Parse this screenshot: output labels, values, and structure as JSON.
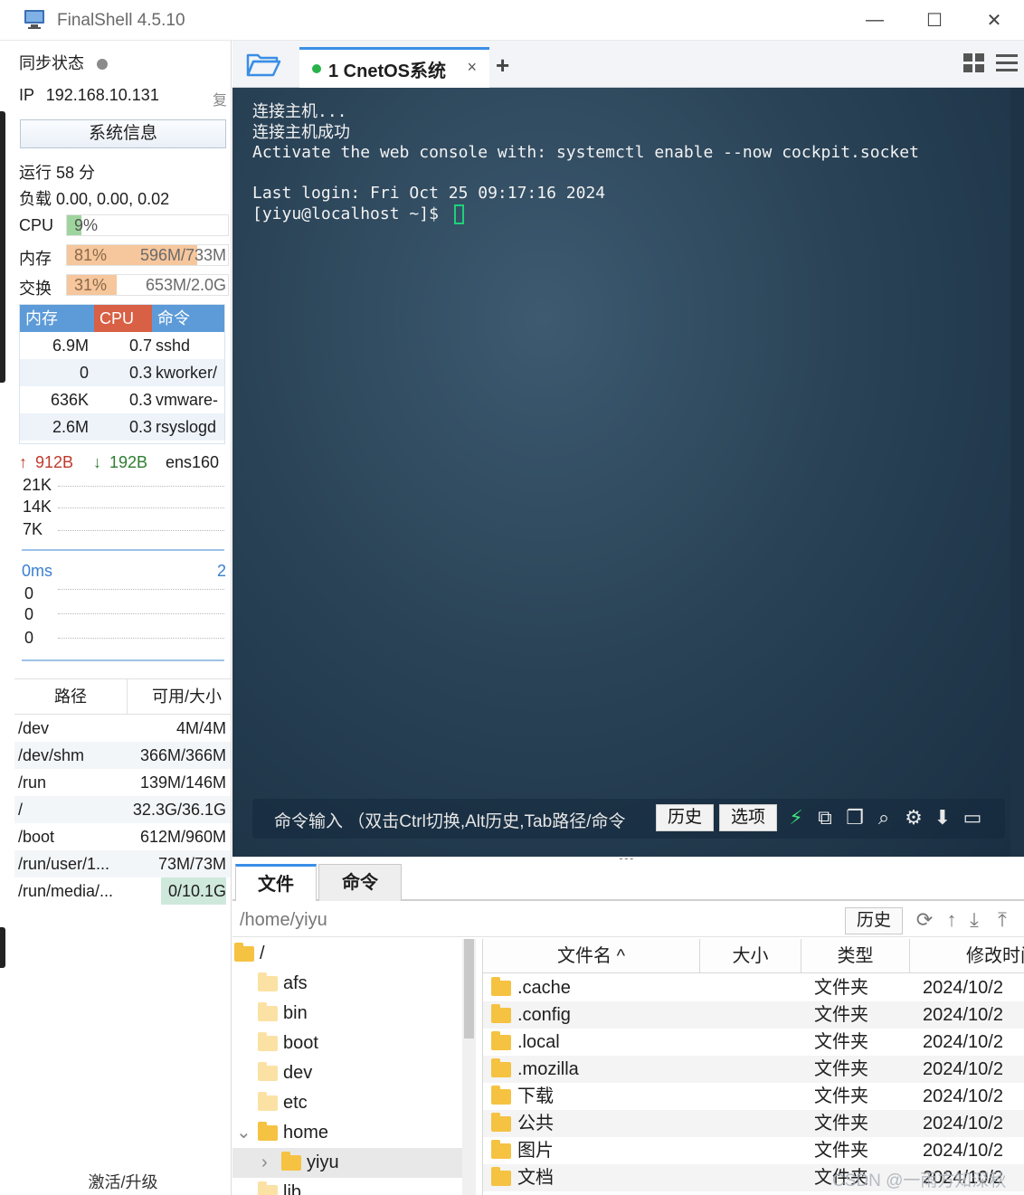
{
  "window": {
    "title": "FinalShell 4.5.10",
    "minimize": "—",
    "maximize": "☐",
    "close": "✕"
  },
  "sidebar": {
    "sync_label": "同步状态",
    "ip_label": "IP",
    "ip_value": "192.168.10.131",
    "copy_label": "复",
    "sysinfo_button": "系统信息",
    "uptime": "运行 58 分",
    "load": "负载 0.00, 0.00, 0.02",
    "cpu": {
      "label": "CPU",
      "percent": "9%",
      "value": 0.09
    },
    "mem": {
      "label": "内存",
      "percent": "81%",
      "amount": "596M/733M",
      "value": 0.81
    },
    "swap": {
      "label": "交换",
      "percent": "31%",
      "amount": "653M/2.0G",
      "value": 0.31
    },
    "process_table": {
      "headers": [
        "内存",
        "CPU",
        "命令"
      ],
      "rows": [
        {
          "mem": "6.9M",
          "cpu": "0.7",
          "cmd": "sshd"
        },
        {
          "mem": "0",
          "cpu": "0.3",
          "cmd": "kworker/"
        },
        {
          "mem": "636K",
          "cpu": "0.3",
          "cmd": "vmware-"
        },
        {
          "mem": "2.6M",
          "cpu": "0.3",
          "cmd": "rsyslogd"
        }
      ]
    },
    "network": {
      "up": "912B",
      "down": "192B",
      "interface": "ens160",
      "ticks": [
        "21K",
        "14K",
        "7K"
      ]
    },
    "ping": {
      "latency": "0ms",
      "right": "2",
      "ticks": [
        "0",
        "0",
        "0"
      ]
    },
    "disk_table": {
      "headers": [
        "路径",
        "可用/大小"
      ],
      "rows": [
        {
          "path": "/dev",
          "value": "4M/4M"
        },
        {
          "path": "/dev/shm",
          "value": "366M/366M"
        },
        {
          "path": "/run",
          "value": "139M/146M"
        },
        {
          "path": "/",
          "value": "32.3G/36.1G"
        },
        {
          "path": "/boot",
          "value": "612M/960M"
        },
        {
          "path": "/run/user/1...",
          "value": "73M/73M"
        },
        {
          "path": "/run/media/...",
          "value": "0/10.1G"
        }
      ]
    },
    "activate": "激活/升级"
  },
  "tabs": {
    "active_label": "1 CnetOS系统",
    "close": "×",
    "add": "+"
  },
  "terminal": {
    "lines": [
      "连接主机...",
      "连接主机成功",
      "Activate the web console with: systemctl enable --now cockpit.socket",
      "",
      "Last login: Fri Oct 25 09:17:16 2024"
    ],
    "prompt": "[yiyu@localhost ~]$ ",
    "command_input": "命令输入 （双击Ctrl切换,Alt历史,Tab路径/命令",
    "history_button": "历史",
    "options_button": "选项"
  },
  "bottom_panel": {
    "tabs": [
      "文件",
      "命令"
    ],
    "path": "/home/yiyu",
    "history_button": "历史",
    "tree": [
      {
        "name": "/",
        "indent": 0,
        "expander": ""
      },
      {
        "name": "afs",
        "indent": 1,
        "expander": ""
      },
      {
        "name": "bin",
        "indent": 1,
        "expander": ""
      },
      {
        "name": "boot",
        "indent": 1,
        "expander": ""
      },
      {
        "name": "dev",
        "indent": 1,
        "expander": ""
      },
      {
        "name": "etc",
        "indent": 1,
        "expander": ""
      },
      {
        "name": "home",
        "indent": 1,
        "expander": "⌄"
      },
      {
        "name": "yiyu",
        "indent": 2,
        "expander": "›"
      },
      {
        "name": "lib",
        "indent": 1,
        "expander": ""
      }
    ],
    "file_headers": {
      "name": "文件名 ^",
      "size": "大小",
      "type": "类型",
      "modified": "修改时间"
    },
    "files": [
      {
        "name": ".cache",
        "type": "文件夹",
        "date": "2024/10/2"
      },
      {
        "name": ".config",
        "type": "文件夹",
        "date": "2024/10/2"
      },
      {
        "name": ".local",
        "type": "文件夹",
        "date": "2024/10/2"
      },
      {
        "name": ".mozilla",
        "type": "文件夹",
        "date": "2024/10/2"
      },
      {
        "name": "下载",
        "type": "文件夹",
        "date": "2024/10/2"
      },
      {
        "name": "公共",
        "type": "文件夹",
        "date": "2024/10/2"
      },
      {
        "name": "图片",
        "type": "文件夹",
        "date": "2024/10/2"
      },
      {
        "name": "文档",
        "type": "文件夹",
        "date": "2024/10/2"
      }
    ]
  },
  "watermark": "CSDN @一雨方知深秋",
  "colors": {
    "accent_blue": "#3a8ee6",
    "cpu_green": "#9ed59e",
    "mem_orange": "#f6c69c",
    "proc_header_blue": "#5d9bd8",
    "proc_header_red": "#d86045",
    "terminal_bg": "#2a4357",
    "cursor_green": "#1fd17a",
    "folder_yellow": "#f5c242"
  }
}
